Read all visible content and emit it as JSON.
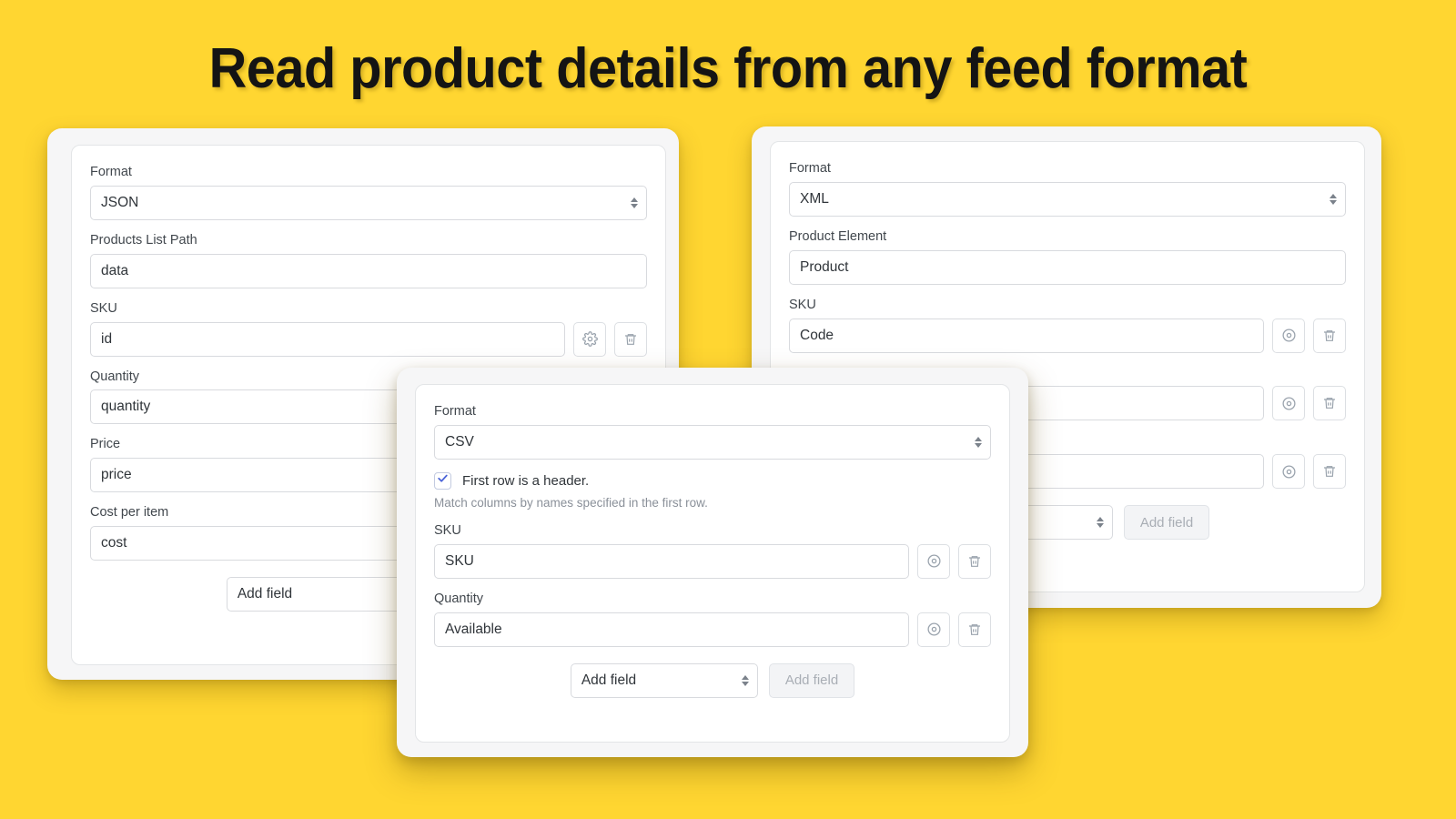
{
  "page": {
    "title": "Read product details from any feed format",
    "background_color": "#FFD631",
    "accent_color": "#4a63d8"
  },
  "icons": {
    "gear": "gear-icon",
    "trash": "trash-icon",
    "check": "check-icon",
    "stepper": "select-stepper-icon"
  },
  "cards": {
    "json": {
      "format_label": "Format",
      "format_value": "JSON",
      "path_label": "Products List Path",
      "path_value": "data",
      "fields": [
        {
          "label": "SKU",
          "value": "id"
        },
        {
          "label": "Quantity",
          "value": "quantity"
        },
        {
          "label": "Price",
          "value": "price"
        },
        {
          "label": "Cost per item",
          "value": "cost"
        }
      ],
      "add_field_select": "Add field",
      "add_field_button": "Add field"
    },
    "xml": {
      "format_label": "Format",
      "format_value": "XML",
      "element_label": "Product Element",
      "element_value": "Product",
      "fields": [
        {
          "label": "SKU",
          "value": "Code"
        },
        {
          "label": "",
          "value": ""
        },
        {
          "label": "",
          "value": ""
        }
      ],
      "add_field_select": "",
      "add_field_button": "Add field"
    },
    "csv": {
      "format_label": "Format",
      "format_value": "CSV",
      "header_checkbox_label": "First row is a header.",
      "header_checkbox_checked": true,
      "header_help_text": "Match columns by names specified in the first row.",
      "fields": [
        {
          "label": "SKU",
          "value": "SKU"
        },
        {
          "label": "Quantity",
          "value": "Available"
        }
      ],
      "add_field_select": "Add field",
      "add_field_button": "Add field"
    }
  }
}
